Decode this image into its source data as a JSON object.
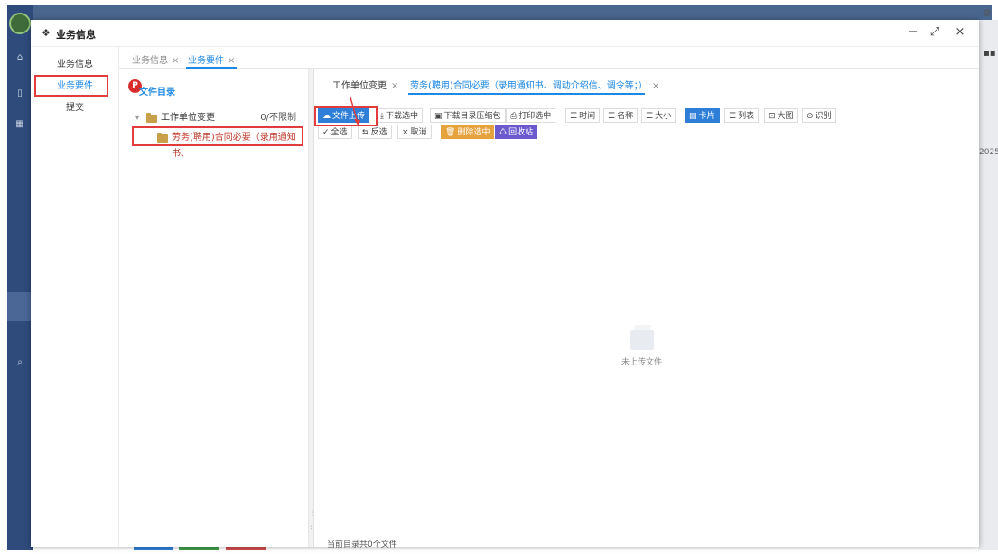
{
  "window": {
    "title": "业务信息",
    "controls": {
      "minimize": "−",
      "restore": "⤢",
      "close": "×"
    }
  },
  "left_nav": {
    "items": [
      {
        "label": "业务信息"
      },
      {
        "label": "业务要件"
      },
      {
        "label": "提交"
      }
    ]
  },
  "top_tabs": [
    {
      "label": "业务信息",
      "close": "×"
    },
    {
      "label": "业务要件",
      "close": "×"
    }
  ],
  "directory": {
    "badge": "P",
    "title": "文件目录",
    "tree": {
      "parent": {
        "label": "工作单位变更",
        "limit": "0/不限制",
        "caret": "▾"
      },
      "child": {
        "label": "劳务(聘用)合同必要（录用通知书、"
      }
    }
  },
  "sub_tabs": [
    {
      "label": "工作单位变更",
      "close": "×"
    },
    {
      "label": "劳务(聘用)合同必要（录用通知书、调动介绍信、调令等；）",
      "close": "×"
    }
  ],
  "toolbar": {
    "row1": [
      {
        "label": "文件上传",
        "icon": "☁"
      },
      {
        "label": "下载选中",
        "icon": "⤓"
      },
      {
        "label": "下载目录压缩包",
        "icon": "▣"
      },
      {
        "label": "打印选中",
        "icon": "⎙"
      },
      {
        "label": "时间",
        "icon": "☰"
      },
      {
        "label": "名称",
        "icon": "☰"
      },
      {
        "label": "大小",
        "icon": "☰"
      },
      {
        "label": "卡片",
        "icon": "▤"
      },
      {
        "label": "列表",
        "icon": "☰"
      },
      {
        "label": "大图",
        "icon": "⊡"
      },
      {
        "label": "识别",
        "icon": "⊙"
      }
    ],
    "row2": [
      {
        "label": "全选",
        "icon": "✓"
      },
      {
        "label": "反选",
        "icon": "⇆"
      },
      {
        "label": "取消",
        "icon": "×"
      },
      {
        "label": "删除选中",
        "icon": "🗑"
      },
      {
        "label": "回收站",
        "icon": "♺"
      }
    ]
  },
  "empty_state": {
    "text": "未上传文件"
  },
  "status": {
    "text": "当前目录共0个文件"
  },
  "background": {
    "year": "2025"
  },
  "colors": {
    "accent": "#1e88e5",
    "highlight": "#e23b3b",
    "primary_btn": "#2f7fd8"
  }
}
